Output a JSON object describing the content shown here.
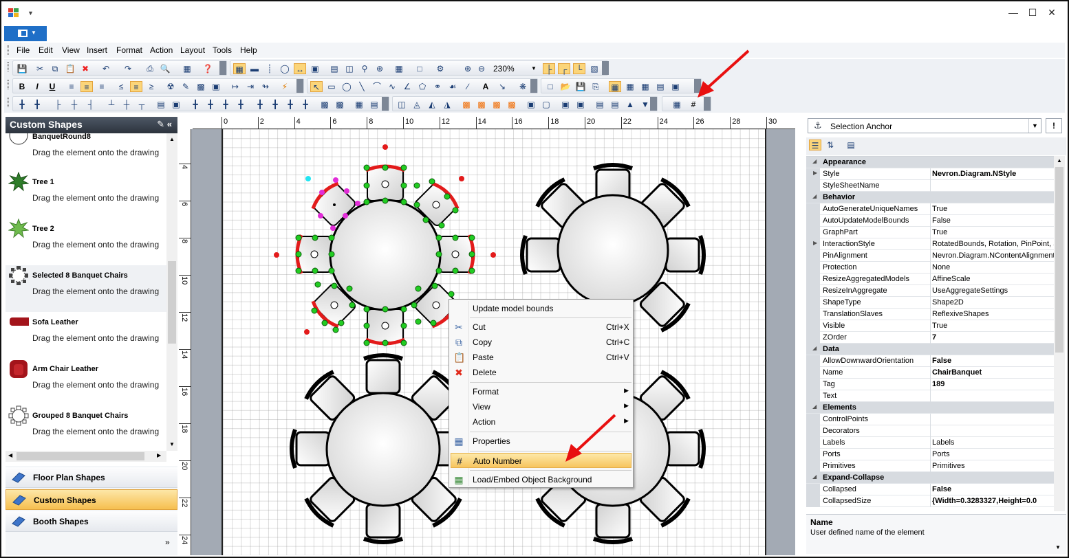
{
  "menu": [
    "File",
    "Edit",
    "View",
    "Insert",
    "Format",
    "Action",
    "Layout",
    "Tools",
    "Help"
  ],
  "toolbar": {
    "zoom_value": "230%"
  },
  "library": {
    "title": "Custom Shapes",
    "items": [
      {
        "name": "BanquetRound8",
        "desc": "Drag the element onto the drawing"
      },
      {
        "name": "Tree 1",
        "desc": "Drag the element onto the drawing"
      },
      {
        "name": "Tree 2",
        "desc": "Drag the element onto the drawing"
      },
      {
        "name": "Selected 8 Banquet Chairs",
        "desc": "Drag the element onto the drawing"
      },
      {
        "name": "Sofa Leather",
        "desc": "Drag the element onto the drawing"
      },
      {
        "name": "Arm Chair Leather",
        "desc": "Drag the element onto the drawing"
      },
      {
        "name": "Grouped 8 Banquet Chairs",
        "desc": "Drag the element onto the drawing"
      }
    ],
    "tabs": [
      "Floor Plan Shapes",
      "Custom Shapes",
      "Booth Shapes"
    ],
    "active_tab": "Custom Shapes"
  },
  "ruler": {
    "h": [
      "0",
      "2",
      "4",
      "6",
      "8",
      "10",
      "12",
      "14",
      "16",
      "18",
      "20",
      "22",
      "24",
      "26",
      "28",
      "30"
    ],
    "v": [
      "4",
      "6",
      "8",
      "10",
      "12",
      "14",
      "16",
      "18",
      "20",
      "22",
      "24"
    ]
  },
  "context_menu": [
    {
      "label": "Update model bounds",
      "shortcut": "",
      "icon": ""
    },
    {
      "label": "Cut",
      "shortcut": "Ctrl+X",
      "icon": "scissors-icon"
    },
    {
      "label": "Copy",
      "shortcut": "Ctrl+C",
      "icon": "copy-icon"
    },
    {
      "label": "Paste",
      "shortcut": "Ctrl+V",
      "icon": "paste-icon"
    },
    {
      "label": "Delete",
      "shortcut": "",
      "icon": "delete-icon"
    },
    {
      "label": "Format",
      "shortcut": "",
      "icon": "",
      "submenu": true
    },
    {
      "label": "View",
      "shortcut": "",
      "icon": "",
      "submenu": true
    },
    {
      "label": "Action",
      "shortcut": "",
      "icon": "",
      "submenu": true
    },
    {
      "label": "Properties",
      "shortcut": "",
      "icon": "properties-icon"
    },
    {
      "label": "Auto Number",
      "shortcut": "",
      "icon": "hash-icon",
      "highlighted": true
    },
    {
      "label": "Load/Embed Object Background",
      "shortcut": "",
      "icon": "image-icon"
    }
  ],
  "properties": {
    "selector": "Selection Anchor",
    "rows": [
      {
        "type": "cat",
        "k": "Appearance"
      },
      {
        "k": "Style",
        "v": "Nevron.Diagram.NStyle",
        "bold": true,
        "exp": true
      },
      {
        "k": "StyleSheetName",
        "v": ""
      },
      {
        "type": "cat",
        "k": "Behavior"
      },
      {
        "k": "AutoGenerateUniqueNames",
        "v": "True"
      },
      {
        "k": "AutoUpdateModelBounds",
        "v": "False"
      },
      {
        "k": "GraphPart",
        "v": "True"
      },
      {
        "k": "InteractionStyle",
        "v": "RotatedBounds, Rotation, PinPoint, S",
        "exp": true
      },
      {
        "k": "PinAlignment",
        "v": "Nevron.Diagram.NContentAlignment"
      },
      {
        "k": "Protection",
        "v": "None"
      },
      {
        "k": "ResizeAggregatedModels",
        "v": "AffineScale"
      },
      {
        "k": "ResizeInAggregate",
        "v": "UseAggregateSettings"
      },
      {
        "k": "ShapeType",
        "v": "Shape2D"
      },
      {
        "k": "TranslationSlaves",
        "v": "ReflexiveShapes"
      },
      {
        "k": "Visible",
        "v": "True"
      },
      {
        "k": "ZOrder",
        "v": "7",
        "bold": true
      },
      {
        "type": "cat",
        "k": "Data"
      },
      {
        "k": "AllowDownwardOrientation",
        "v": "False",
        "bold": true
      },
      {
        "k": "Name",
        "v": "ChairBanquet",
        "bold": true
      },
      {
        "k": "Tag",
        "v": "189",
        "bold": true
      },
      {
        "k": "Text",
        "v": ""
      },
      {
        "type": "cat",
        "k": "Elements"
      },
      {
        "k": "ControlPoints",
        "v": ""
      },
      {
        "k": "Decorators",
        "v": ""
      },
      {
        "k": "Labels",
        "v": "Labels"
      },
      {
        "k": "Ports",
        "v": "Ports"
      },
      {
        "k": "Primitives",
        "v": "Primitives"
      },
      {
        "type": "cat",
        "k": "Expand-Collapse"
      },
      {
        "k": "Collapsed",
        "v": "False",
        "bold": true
      },
      {
        "k": "CollapsedSize",
        "v": "{Width=0.3283327,Height=0.0",
        "bold": true
      }
    ],
    "description_title": "Name",
    "description_text": "User defined name of the element"
  },
  "colors": {
    "accent": "#1f6fc7",
    "selection": "#f6bf4f",
    "handle": "#22cc22",
    "arrow": "#e81010"
  }
}
